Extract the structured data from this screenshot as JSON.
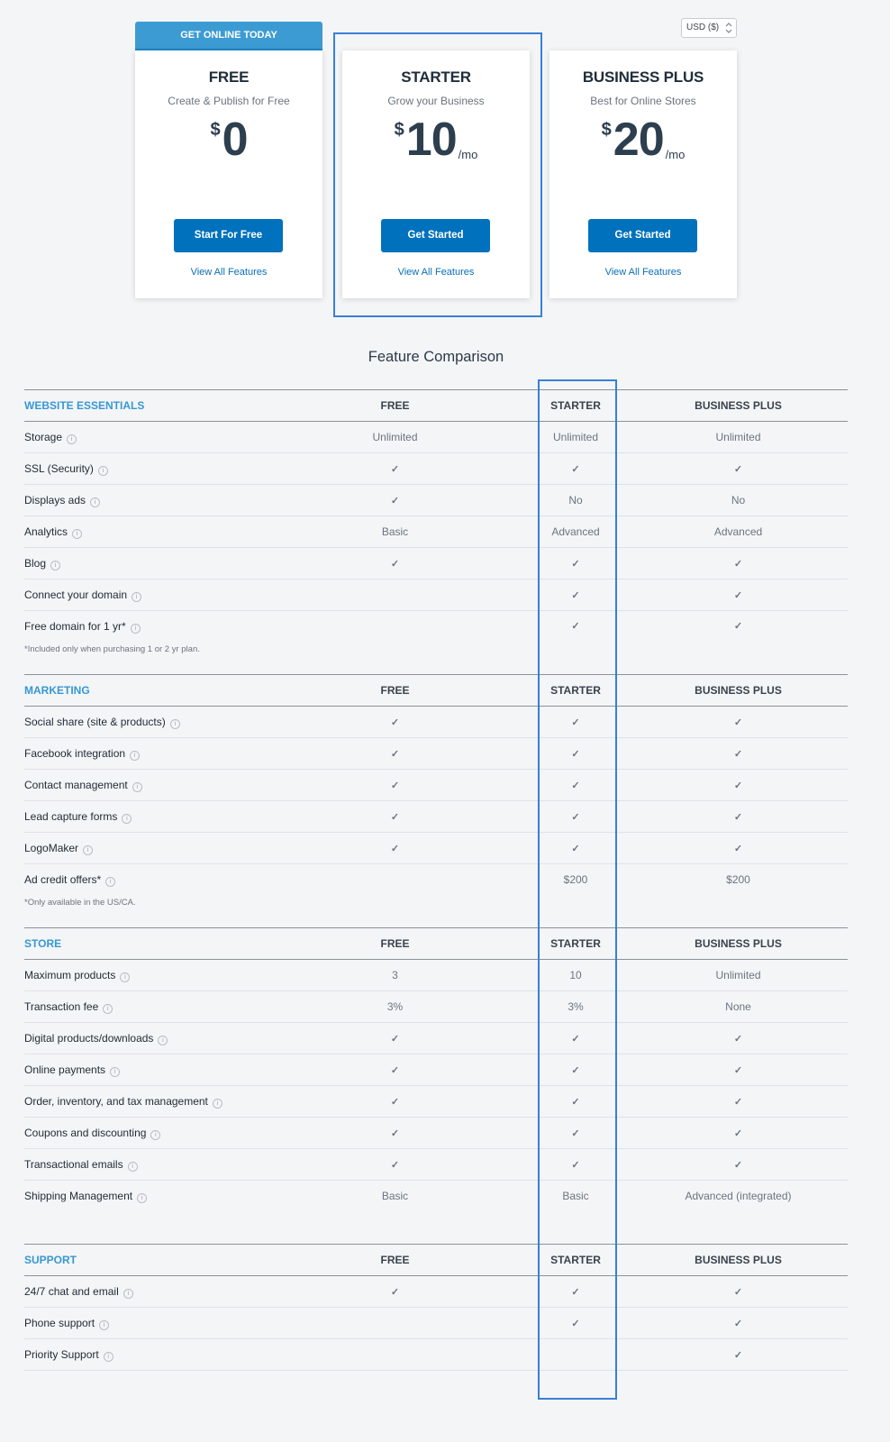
{
  "currency": {
    "value": "USD ($)"
  },
  "ribbon": "GET ONLINE TODAY",
  "plans": [
    {
      "name": "FREE",
      "subtitle": "Create & Publish for Free",
      "currency_symbol": "$",
      "price": "0",
      "period": "",
      "button": "Start For Free",
      "link": "View All Features"
    },
    {
      "name": "STARTER",
      "subtitle": "Grow your Business",
      "currency_symbol": "$",
      "price": "10",
      "period": "/mo",
      "button": "Get Started",
      "link": "View All Features"
    },
    {
      "name": "BUSINESS PLUS",
      "subtitle": "Best for Online Stores",
      "currency_symbol": "$",
      "price": "20",
      "period": "/mo",
      "button": "Get Started",
      "link": "View All Features"
    }
  ],
  "comparison": {
    "title": "Feature Comparison",
    "columns": [
      "FREE",
      "STARTER",
      "BUSINESS PLUS"
    ],
    "check_symbol": "✓",
    "info_symbol": "i",
    "sections": [
      {
        "name": "WEBSITE ESSENTIALS",
        "rows": [
          {
            "feature": "Storage",
            "values": [
              "Unlimited",
              "Unlimited",
              "Unlimited"
            ]
          },
          {
            "feature": "SSL (Security)",
            "values": [
              "✓",
              "✓",
              "✓"
            ]
          },
          {
            "feature": "Displays ads",
            "values": [
              "✓",
              "No",
              "No"
            ]
          },
          {
            "feature": "Analytics",
            "values": [
              "Basic",
              "Advanced",
              "Advanced"
            ]
          },
          {
            "feature": "Blog",
            "values": [
              "✓",
              "✓",
              "✓"
            ]
          },
          {
            "feature": "Connect your domain",
            "values": [
              "",
              "✓",
              "✓"
            ]
          },
          {
            "feature": "Free domain for 1 yr*",
            "note": "*Included only when purchasing 1 or 2 yr plan.",
            "values": [
              "",
              "✓",
              "✓"
            ]
          }
        ]
      },
      {
        "name": "MARKETING",
        "rows": [
          {
            "feature": "Social share (site & products)",
            "values": [
              "✓",
              "✓",
              "✓"
            ]
          },
          {
            "feature": "Facebook integration",
            "values": [
              "✓",
              "✓",
              "✓"
            ]
          },
          {
            "feature": "Contact management",
            "values": [
              "✓",
              "✓",
              "✓"
            ]
          },
          {
            "feature": "Lead capture forms",
            "values": [
              "✓",
              "✓",
              "✓"
            ]
          },
          {
            "feature": "LogoMaker",
            "values": [
              "✓",
              "✓",
              "✓"
            ]
          },
          {
            "feature": "Ad credit offers*",
            "note": "*Only available in the US/CA.",
            "values": [
              "",
              "$200",
              "$200"
            ]
          }
        ]
      },
      {
        "name": "STORE",
        "rows": [
          {
            "feature": "Maximum products",
            "values": [
              "3",
              "10",
              "Unlimited"
            ]
          },
          {
            "feature": "Transaction fee",
            "values": [
              "3%",
              "3%",
              "None"
            ]
          },
          {
            "feature": "Digital products/downloads",
            "values": [
              "✓",
              "✓",
              "✓"
            ]
          },
          {
            "feature": "Online payments",
            "values": [
              "✓",
              "✓",
              "✓"
            ]
          },
          {
            "feature": "Order, inventory, and tax management",
            "values": [
              "✓",
              "✓",
              "✓"
            ]
          },
          {
            "feature": "Coupons and discounting",
            "values": [
              "✓",
              "✓",
              "✓"
            ]
          },
          {
            "feature": "Transactional emails",
            "values": [
              "✓",
              "✓",
              "✓"
            ]
          },
          {
            "feature": "Shipping Management",
            "values": [
              "Basic",
              "Basic",
              "Advanced (integrated)"
            ],
            "tall": true
          }
        ]
      },
      {
        "name": "SUPPORT",
        "rows": [
          {
            "feature": "24/7 chat and email",
            "values": [
              "✓",
              "✓",
              "✓"
            ]
          },
          {
            "feature": "Phone support",
            "values": [
              "",
              "✓",
              "✓"
            ]
          },
          {
            "feature": "Priority Support",
            "values": [
              "",
              "",
              "✓"
            ]
          }
        ]
      }
    ]
  }
}
